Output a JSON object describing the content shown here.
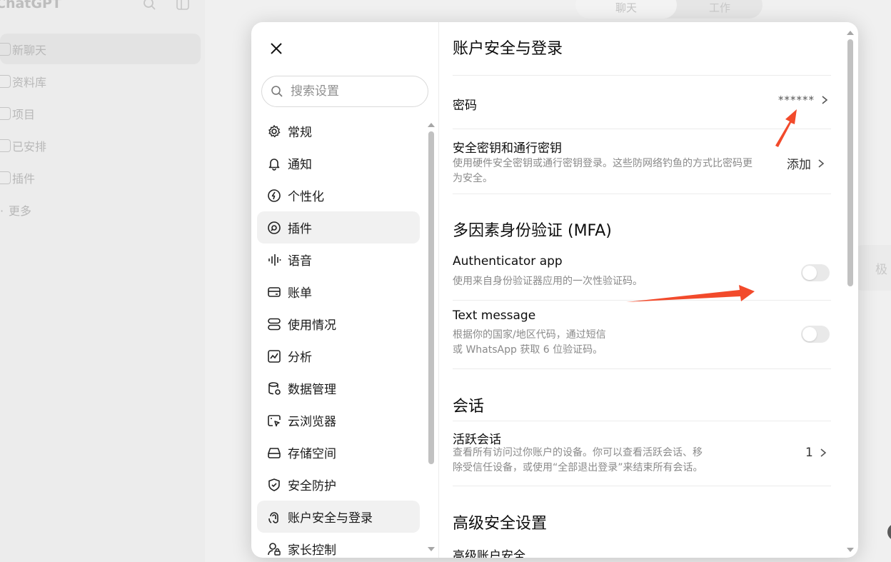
{
  "background": {
    "app_title": "ChatGPT",
    "nav_items": [
      "新聊天",
      "资料库",
      "项目",
      "已安排",
      "插件",
      "更多"
    ],
    "mode_tabs": [
      "聊天",
      "工作"
    ],
    "right_card_text": "极"
  },
  "settings": {
    "search_placeholder": "搜索设置",
    "menu": [
      {
        "label": "常规",
        "icon": "gear-icon"
      },
      {
        "label": "通知",
        "icon": "bell-icon"
      },
      {
        "label": "个性化",
        "icon": "personalization-icon"
      },
      {
        "label": "插件",
        "icon": "plugin-icon"
      },
      {
        "label": "语音",
        "icon": "waveform-icon"
      },
      {
        "label": "账单",
        "icon": "card-icon"
      },
      {
        "label": "使用情况",
        "icon": "usage-icon"
      },
      {
        "label": "分析",
        "icon": "chart-icon"
      },
      {
        "label": "数据管理",
        "icon": "database-icon"
      },
      {
        "label": "云浏览器",
        "icon": "cloud-browser-icon"
      },
      {
        "label": "存储空间",
        "icon": "storage-icon"
      },
      {
        "label": "安全防护",
        "icon": "shield-icon"
      },
      {
        "label": "账户安全与登录",
        "icon": "account-security-icon"
      },
      {
        "label": "家长控制",
        "icon": "parental-icon"
      }
    ],
    "active_menu": "账户安全与登录",
    "page_title": "账户安全与登录",
    "password": {
      "title": "密码",
      "value": "******"
    },
    "passkeys": {
      "title": "安全密钥和通行密钥",
      "desc_line1": "使用硬件安全密钥或通行密钥登录。这些防网络钓鱼的方式比密码更",
      "desc_line2": "为安全。",
      "action": "添加"
    },
    "mfa": {
      "heading": "多因素身份验证 (MFA)",
      "authenticator": {
        "title": "Authenticator app",
        "desc": "使用来自身份验证器应用的一次性验证码。",
        "enabled": false
      },
      "sms": {
        "title": "Text message",
        "desc_line1": "根据你的国家/地区代码，通过短信",
        "desc_line2": "或 WhatsApp 获取 6 位验证码。",
        "enabled": false
      }
    },
    "sessions": {
      "heading": "会话",
      "active": {
        "title": "活跃会话",
        "desc_line1": "查看所有访问过你账户的设备。你可以查看活跃会话、移",
        "desc_line2": "除受信任设备，或使用“全部退出登录”来结束所有会话。",
        "count": "1"
      }
    },
    "advanced": {
      "heading": "高级安全设置",
      "item_title": "高级账户安全"
    }
  },
  "colors": {
    "annotation_arrow": "#f24a2b",
    "toggle_off": "#e9e9e9"
  }
}
